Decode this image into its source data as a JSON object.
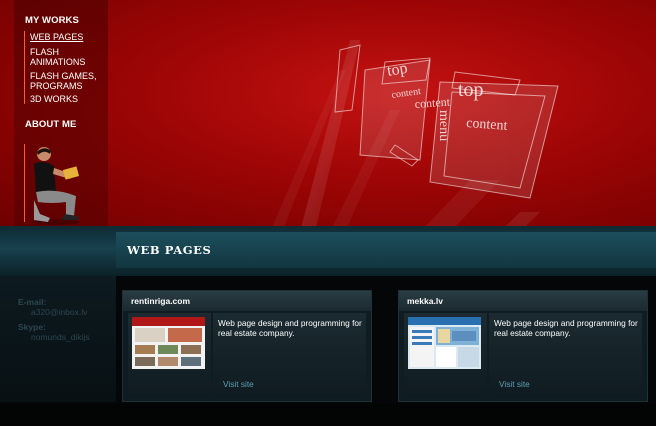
{
  "nav": {
    "my_works": "MY WORKS",
    "items": [
      {
        "label": "WEB PAGES",
        "active": true
      },
      {
        "label": "FLASH ANIMATIONS",
        "active": false
      },
      {
        "label": "FLASH GAMES, PROGRAMS",
        "active": false
      },
      {
        "label": "3D WORKS",
        "active": false
      }
    ],
    "about_me": "ABOUT ME"
  },
  "banner_words": [
    "top",
    "content",
    "content",
    "menu",
    "top",
    "content"
  ],
  "section": {
    "title": "WEB PAGES"
  },
  "contact": {
    "email_label": "E-mail:",
    "email_value": "a320@inbox.lv",
    "skype_label": "Skype:",
    "skype_value": "nomunds_dikijs"
  },
  "cards": [
    {
      "title": "rentinriga.com",
      "description": "Web page design and programming for real estate company.",
      "link": "Visit site"
    },
    {
      "title": "mekka.lv",
      "description": "Web page design and programming for real estate company.",
      "link": "Visit site"
    }
  ],
  "colors": {
    "banner_red": "#b00808",
    "teal": "#17414d",
    "link": "#5f9fb3",
    "accent_line": "#ff5a3a"
  }
}
